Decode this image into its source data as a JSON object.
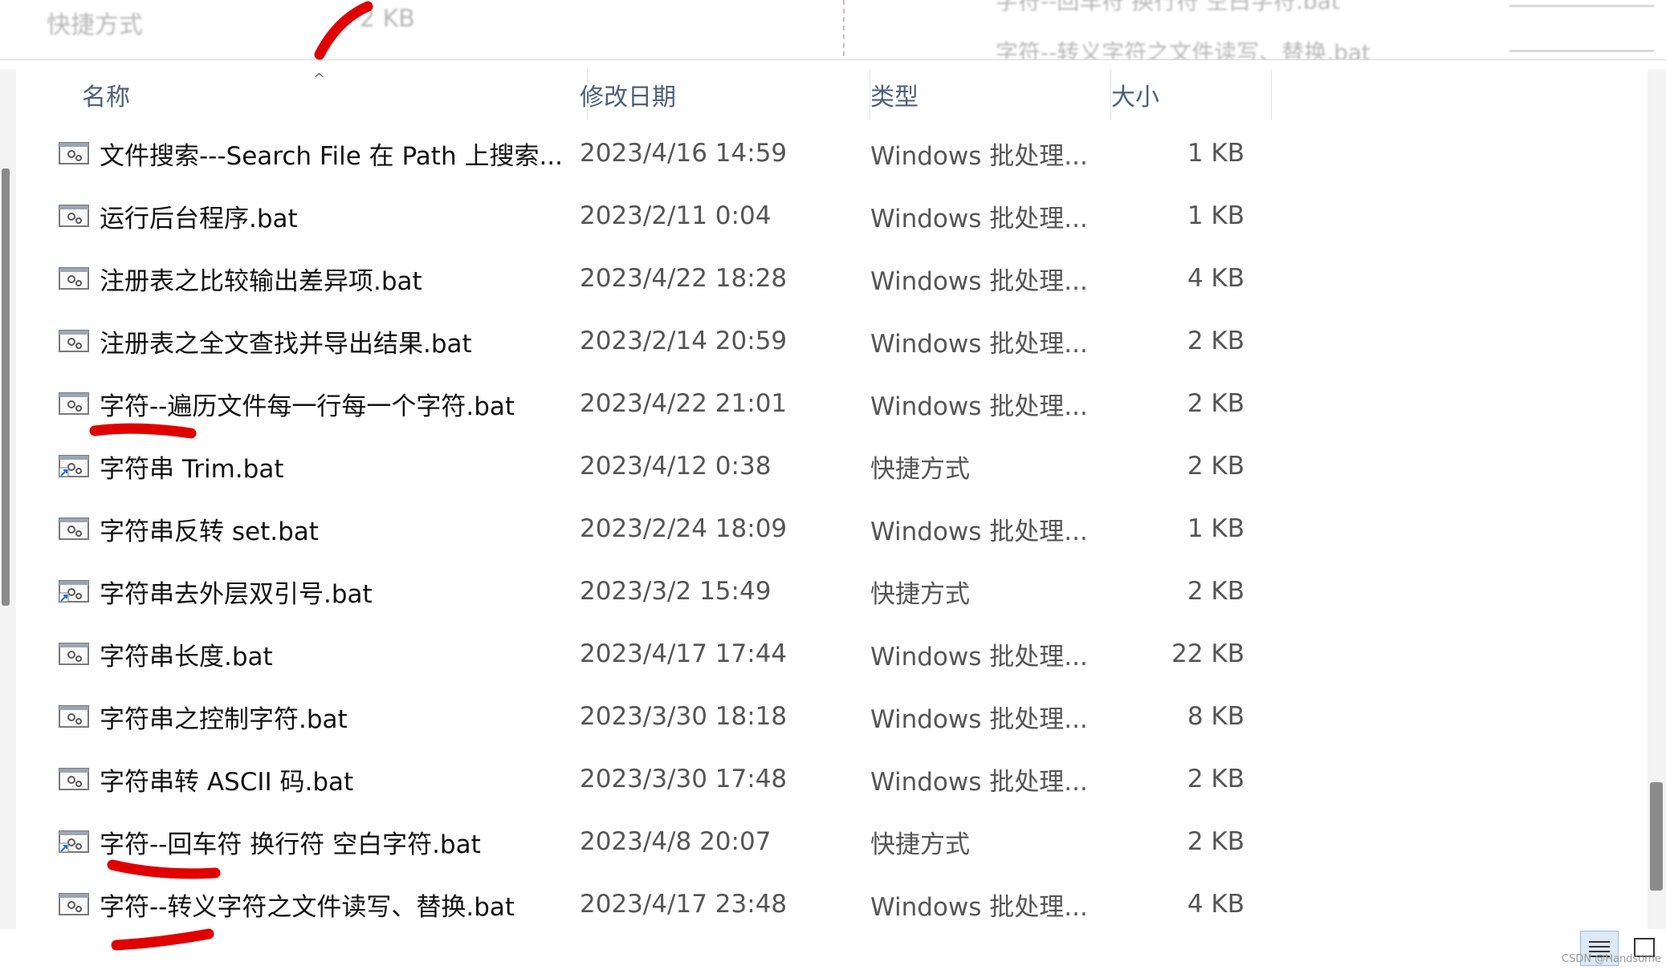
{
  "top_strip": {
    "ghost_left_type": "快捷方式",
    "ghost_left_size": "2 KB",
    "ghost_right_line1": "字符--回车符 换行符 空白字符.bat",
    "ghost_right_line2": "字符--转义字符之文件读写、替换.bat"
  },
  "columns": {
    "name": "名称",
    "date": "修改日期",
    "type": "类型",
    "size": "大小"
  },
  "sort_indicator": "^",
  "files": [
    {
      "name": "文件搜索---Search File 在 Path  上搜索...",
      "date": "2023/4/16 14:59",
      "type": "Windows 批处理...",
      "size": "1 KB",
      "icon": "batch-file-icon"
    },
    {
      "name": "运行后台程序.bat",
      "date": "2023/2/11 0:04",
      "type": "Windows 批处理...",
      "size": "1 KB",
      "icon": "batch-file-icon"
    },
    {
      "name": "注册表之比较输出差异项.bat",
      "date": "2023/4/22 18:28",
      "type": "Windows 批处理...",
      "size": "4 KB",
      "icon": "batch-file-icon"
    },
    {
      "name": "注册表之全文查找并导出结果.bat",
      "date": "2023/2/14 20:59",
      "type": "Windows 批处理...",
      "size": "2 KB",
      "icon": "batch-file-icon"
    },
    {
      "name": "字符--遍历文件每一行每一个字符.bat",
      "date": "2023/4/22 21:01",
      "type": "Windows 批处理...",
      "size": "2 KB",
      "icon": "batch-file-icon"
    },
    {
      "name": "字符串 Trim.bat",
      "date": "2023/4/12 0:38",
      "type": "快捷方式",
      "size": "2 KB",
      "icon": "shortcut-icon"
    },
    {
      "name": "字符串反转 set.bat",
      "date": "2023/2/24 18:09",
      "type": "Windows 批处理...",
      "size": "1 KB",
      "icon": "batch-file-icon"
    },
    {
      "name": "字符串去外层双引号.bat",
      "date": "2023/3/2 15:49",
      "type": "快捷方式",
      "size": "2 KB",
      "icon": "shortcut-icon"
    },
    {
      "name": "字符串长度.bat",
      "date": "2023/4/17 17:44",
      "type": "Windows 批处理...",
      "size": "22 KB",
      "icon": "batch-file-icon"
    },
    {
      "name": "字符串之控制字符.bat",
      "date": "2023/3/30 18:18",
      "type": "Windows 批处理...",
      "size": "8 KB",
      "icon": "batch-file-icon"
    },
    {
      "name": "字符串转 ASCII 码.bat",
      "date": "2023/3/30 17:48",
      "type": "Windows 批处理...",
      "size": "2 KB",
      "icon": "batch-file-icon"
    },
    {
      "name": "字符--回车符 换行符 空白字符.bat",
      "date": "2023/4/8 20:07",
      "type": "快捷方式",
      "size": "2 KB",
      "icon": "shortcut-icon"
    },
    {
      "name": "字符--转义字符之文件读写、替换.bat",
      "date": "2023/4/17 23:48",
      "type": "Windows 批处理...",
      "size": "4 KB",
      "icon": "batch-file-icon"
    }
  ],
  "view_buttons": {
    "details": "details-view-icon",
    "tiles": "large-icons-view-icon"
  },
  "watermark": "CSDN @Handsome",
  "colors": {
    "header_text": "#4c607a",
    "name_text": "#111111",
    "meta_text": "#555555",
    "annotation": "#e00000"
  }
}
